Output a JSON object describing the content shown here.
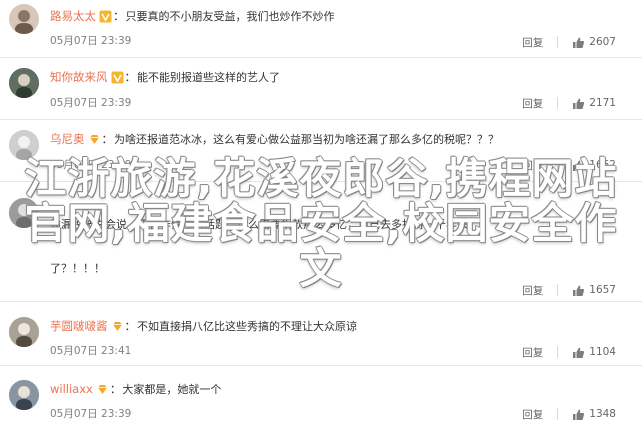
{
  "comments": [
    {
      "username": "路易太太",
      "verified": true,
      "content": "只要真的不小朋友受益，我们也炒作不炒作",
      "content_extra": "",
      "timestamp": "05月07日 23:39",
      "reply_label": "回复",
      "likes": "2607",
      "avatar_color": "#d8c7b8"
    },
    {
      "username": "知你故来风",
      "verified": true,
      "content": "能不能别报道些这样的艺人了",
      "content_extra": "",
      "timestamp": "05月07日 23:39",
      "reply_label": "回复",
      "likes": "2171",
      "avatar_color": "#7c8c7a"
    },
    {
      "username": "乌尼奥",
      "verified": false,
      "content": "为啥还报道范冰冰，这么有爱心做公益那当初为啥还漏了那么多亿的税呢？？？",
      "content_extra": "",
      "timestamp": "05月07日 23:39",
      "reply_label": "回复",
      "likes": "1652",
      "avatar_color": "#c9c9c9"
    },
    {
      "username": "",
      "verified": false,
      "content": "偷漏税被说会说，不仅作假你的话题，这么需要捐款那么多亿，自己去多担持一千年来",
      "content_extra": "了？！！！",
      "timestamp": "",
      "reply_label": "回复",
      "likes": "1657",
      "avatar_color": "#a8a8a8"
    },
    {
      "username": "芋圆啵啵酱",
      "verified": false,
      "content": "不如直接捐八亿比这些秀搞的不理让大众原谅",
      "content_extra": "",
      "timestamp": "05月07日 23:41",
      "reply_label": "回复",
      "likes": "1104",
      "avatar_color": "#b7b0a5"
    },
    {
      "username": "williaxx",
      "verified": false,
      "content": "大家都是，她就一个",
      "content_extra": "",
      "timestamp": "05月07日 23:39",
      "reply_label": "回复",
      "likes": "1348",
      "avatar_color": "#9aa2ad"
    }
  ],
  "overlay_text": "江浙旅游,花溪夜郎谷,携程网站官网,福建食品安全,校园安全作文",
  "colors": {
    "username": "#eb7350",
    "divider": "#e6e6e6",
    "muted": "#808080"
  }
}
